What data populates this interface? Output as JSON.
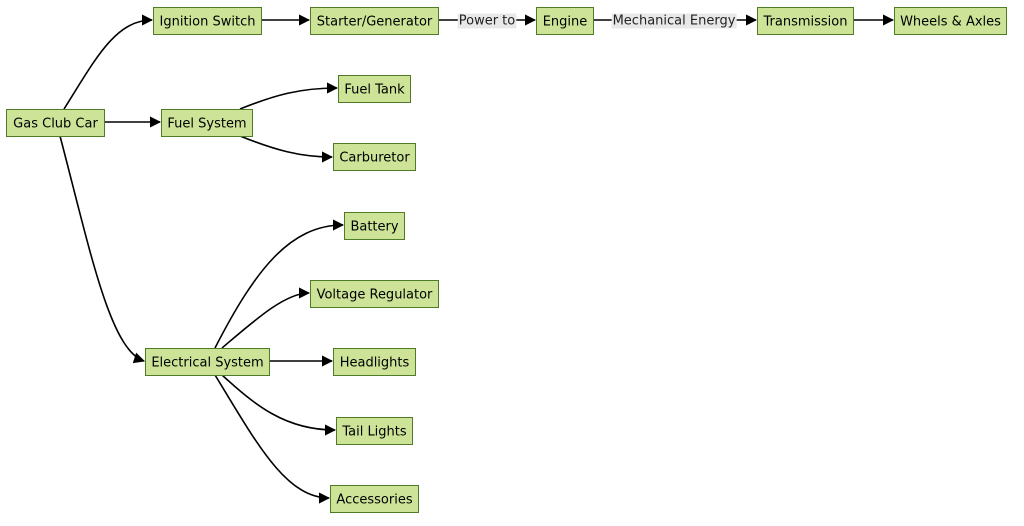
{
  "diagram": {
    "title": "Gas Club Car",
    "node_fill": "#cde498",
    "node_stroke": "#4f7a28",
    "nodes": [
      {
        "id": "car",
        "label": "Gas Club Car"
      },
      {
        "id": "ign",
        "label": "Ignition Switch"
      },
      {
        "id": "starter",
        "label": "Starter/Generator"
      },
      {
        "id": "engine",
        "label": "Engine"
      },
      {
        "id": "trans",
        "label": "Transmission"
      },
      {
        "id": "wheels",
        "label": "Wheels & Axles"
      },
      {
        "id": "fuel",
        "label": "Fuel System"
      },
      {
        "id": "tank",
        "label": "Fuel Tank"
      },
      {
        "id": "carb",
        "label": "Carburetor"
      },
      {
        "id": "elec",
        "label": "Electrical System"
      },
      {
        "id": "battery",
        "label": "Battery"
      },
      {
        "id": "volt",
        "label": "Voltage Regulator"
      },
      {
        "id": "head",
        "label": "Headlights"
      },
      {
        "id": "tail",
        "label": "Tail Lights"
      },
      {
        "id": "acc",
        "label": "Accessories"
      }
    ],
    "edges": [
      {
        "from": "car",
        "to": "ign",
        "label": ""
      },
      {
        "from": "ign",
        "to": "starter",
        "label": ""
      },
      {
        "from": "starter",
        "to": "engine",
        "label": "Power to"
      },
      {
        "from": "engine",
        "to": "trans",
        "label": "Mechanical Energy"
      },
      {
        "from": "trans",
        "to": "wheels",
        "label": ""
      },
      {
        "from": "car",
        "to": "fuel",
        "label": ""
      },
      {
        "from": "fuel",
        "to": "tank",
        "label": ""
      },
      {
        "from": "fuel",
        "to": "carb",
        "label": ""
      },
      {
        "from": "car",
        "to": "elec",
        "label": ""
      },
      {
        "from": "elec",
        "to": "battery",
        "label": ""
      },
      {
        "from": "elec",
        "to": "volt",
        "label": ""
      },
      {
        "from": "elec",
        "to": "head",
        "label": ""
      },
      {
        "from": "elec",
        "to": "tail",
        "label": ""
      },
      {
        "from": "elec",
        "to": "acc",
        "label": ""
      }
    ]
  }
}
